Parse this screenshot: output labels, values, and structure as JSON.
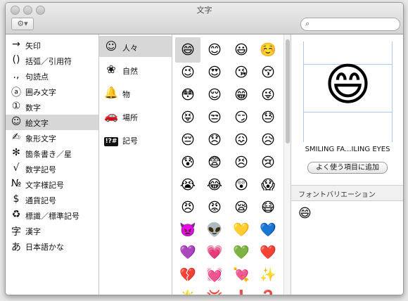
{
  "window": {
    "title": "文字"
  },
  "toolbar": {
    "action_menu": "⚙▾",
    "search_icon": "⌕",
    "search_value": ""
  },
  "categories": [
    {
      "icon": "→",
      "label": "矢印"
    },
    {
      "icon": "()",
      "label": "括弧／引用符"
    },
    {
      "icon": ".,",
      "label": "句読点"
    },
    {
      "icon": "ⓐ",
      "label": "囲み文字"
    },
    {
      "icon": "①",
      "label": "数字"
    },
    {
      "icon": "☺",
      "label": "絵文字",
      "selected": true
    },
    {
      "icon": "✍",
      "label": "象形文字"
    },
    {
      "icon": "✻",
      "label": "箇条書き／星"
    },
    {
      "icon": "√",
      "label": "数学記号"
    },
    {
      "icon": "№",
      "label": "文字様記号"
    },
    {
      "icon": "$",
      "label": "通貨記号"
    },
    {
      "icon": "♻",
      "label": "標識／標準記号"
    },
    {
      "icon": "字",
      "label": "漢字"
    },
    {
      "icon": "あ",
      "label": "日本語かな"
    }
  ],
  "subcategories": [
    {
      "icon": "☺",
      "label": "人々",
      "selected": true
    },
    {
      "icon": "❀",
      "label": "自然"
    },
    {
      "icon": "🔔",
      "label": "物"
    },
    {
      "icon": "🚗",
      "label": "場所"
    },
    {
      "icon": "!?#",
      "label": "記号",
      "boxed": true
    }
  ],
  "emoji_grid": [
    "😄",
    "😊",
    "😃",
    "☺️",
    "😉",
    "😍",
    "😘",
    "😚",
    "😳",
    "😌",
    "😁",
    "😜",
    "😝",
    "😒",
    "😏",
    "😓",
    "😔",
    "😞",
    "😖",
    "😥",
    "😰",
    "😨",
    "😣",
    "😢",
    "😭",
    "😂",
    "😲",
    "😱",
    "😠",
    "😡",
    "😪",
    "😷",
    "👿",
    "👽",
    "💛",
    "💙",
    "💜",
    "💗",
    "💚",
    "❤️",
    "💔",
    "💓",
    "💘",
    "✨",
    "🌟",
    "💢",
    "❗",
    "❓"
  ],
  "preview": {
    "emoji": "😄",
    "name": "SMILING FA...ILING EYES",
    "add_favorite": "よく使う項目に追加"
  },
  "font_variation": {
    "heading": "フォントバリエーション",
    "emoji": "😄"
  }
}
